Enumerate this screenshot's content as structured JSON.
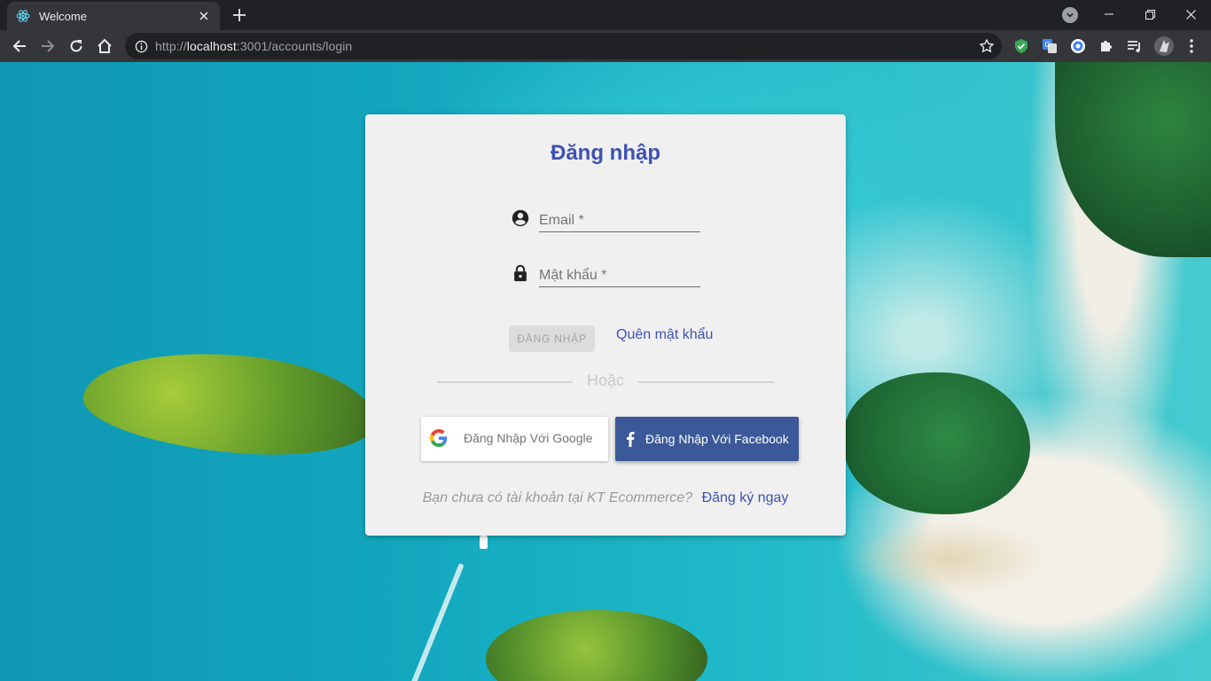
{
  "browser": {
    "tab": {
      "title": "Welcome",
      "favicon": "react-icon"
    },
    "url": {
      "scheme": "http://",
      "host": "localhost",
      "rest": ":3001/accounts/login"
    }
  },
  "login": {
    "title": "Đăng nhập",
    "email_placeholder": "Email *",
    "password_placeholder": "Mật khẩu *",
    "login_button": "ĐĂNG NHẬP",
    "forgot_link": "Quên mật khẩu",
    "or_text": "Hoặc",
    "google_button": "Đăng Nhập Với Google",
    "facebook_button": "Đăng Nhập Với Facebook",
    "signup_question": "Bạn chưa có tài khoản tại KT Ecommerce?",
    "signup_link": "Đăng ký ngay"
  },
  "colors": {
    "primary": "#3f51b5",
    "facebook": "#3b5998",
    "card_bg": "#f0f0f0",
    "chrome_dark": "#202124",
    "chrome_toolbar": "#35363a"
  }
}
